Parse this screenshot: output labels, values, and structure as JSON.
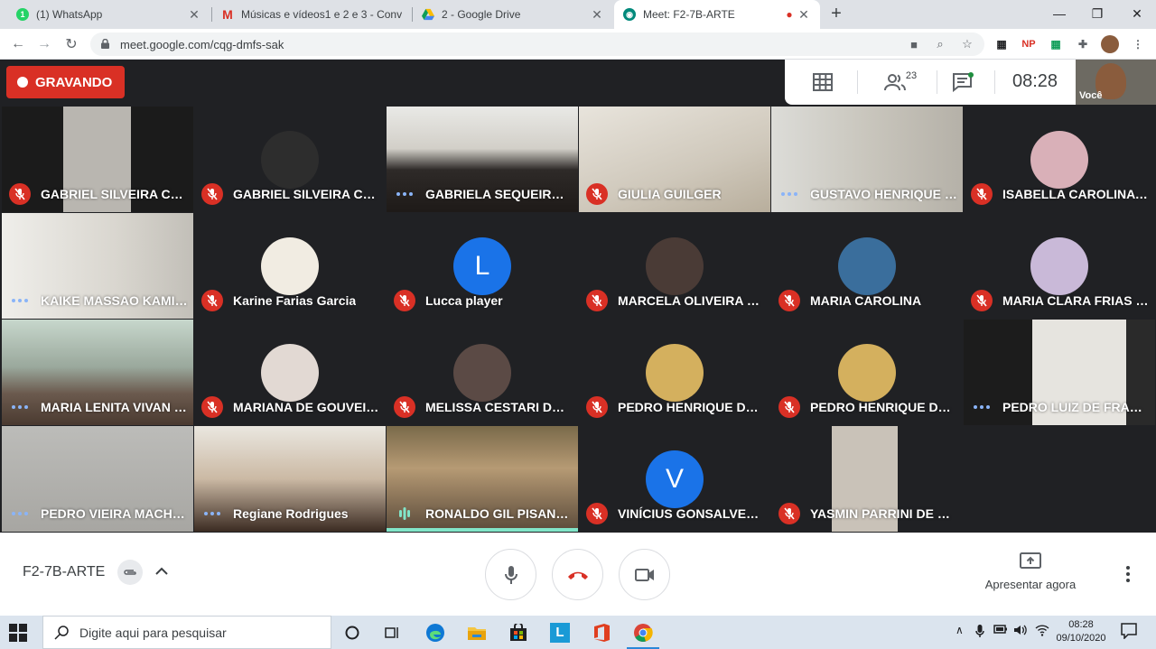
{
  "browser": {
    "tabs": [
      {
        "title": "(1) WhatsApp",
        "icon": "whatsapp-icon",
        "color": "#25d366"
      },
      {
        "title": "Músicas e vídeos1 e 2 e 3 - Conv",
        "icon": "gmail-icon",
        "color": "#d93025"
      },
      {
        "title": "2 - Google Drive",
        "icon": "google-drive-icon",
        "color": "#1a73e8"
      },
      {
        "title": "Meet: F2-7B-ARTE",
        "icon": "google-meet-icon",
        "color": "#00897b"
      }
    ],
    "url": "meet.google.com/cqg-dmfs-sak"
  },
  "meet": {
    "recording_label": "GRAVANDO",
    "participant_count": "23",
    "clock": "08:28",
    "self_label": "Você",
    "meeting_name": "F2-7B-ARTE",
    "present_label": "Apresentar agora",
    "accent_red": "#d93025",
    "accent_blue": "#1a73e8"
  },
  "participants": [
    {
      "name": "GABRIEL SILVEIRA CAR...",
      "status": "muted",
      "display": "video"
    },
    {
      "name": "GABRIEL SILVEIRA CAR...",
      "status": "muted",
      "display": "photo"
    },
    {
      "name": "GABRIELA SEQUEIRA LA...",
      "status": "idle",
      "display": "video"
    },
    {
      "name": "GIULIA GUILGER",
      "status": "muted",
      "display": "video"
    },
    {
      "name": "GUSTAVO HENRIQUE SO...",
      "status": "idle",
      "display": "video"
    },
    {
      "name": "ISABELLA CAROLINA AL...",
      "status": "muted",
      "display": "photo"
    },
    {
      "name": "KAIKE MASSAO KAMID...",
      "status": "idle",
      "display": "video"
    },
    {
      "name": "Karine Farias Garcia",
      "status": "muted",
      "display": "photo"
    },
    {
      "name": "Lucca player",
      "status": "muted",
      "display": "letter",
      "letter": "L"
    },
    {
      "name": "MARCELA OLIVEIRA PU...",
      "status": "muted",
      "display": "photo"
    },
    {
      "name": "MARIA CAROLINA",
      "status": "muted",
      "display": "photo"
    },
    {
      "name": "MARIA CLARA FRIAS GA...",
      "status": "muted",
      "display": "photo"
    },
    {
      "name": "MARIA LENITA VIVAN M...",
      "status": "idle",
      "display": "video"
    },
    {
      "name": "MARIANA DE GOUVEIA ...",
      "status": "muted",
      "display": "photo"
    },
    {
      "name": "MELISSA CESTARI DA SI...",
      "status": "muted",
      "display": "photo"
    },
    {
      "name": "PEDRO HENRIQUE DE A...",
      "status": "muted",
      "display": "photo"
    },
    {
      "name": "PEDRO HENRIQUE DE A...",
      "status": "muted",
      "display": "photo"
    },
    {
      "name": "PEDRO LUIZ DE FRANÇA...",
      "status": "idle",
      "display": "video"
    },
    {
      "name": "PEDRO VIEIRA MACHADO",
      "status": "idle",
      "display": "video"
    },
    {
      "name": "Regiane Rodrigues",
      "status": "idle",
      "display": "video"
    },
    {
      "name": "RONALDO GIL PISANESKI",
      "status": "speaking",
      "display": "video"
    },
    {
      "name": "VINÍCIUS GONSALVES F...",
      "status": "muted",
      "display": "letter",
      "letter": "V"
    },
    {
      "name": "YASMIN PARRINI DE MO...",
      "status": "muted",
      "display": "video"
    }
  ],
  "taskbar": {
    "search_placeholder": "Digite aqui para pesquisar",
    "time": "08:28",
    "date": "09/10/2020"
  }
}
